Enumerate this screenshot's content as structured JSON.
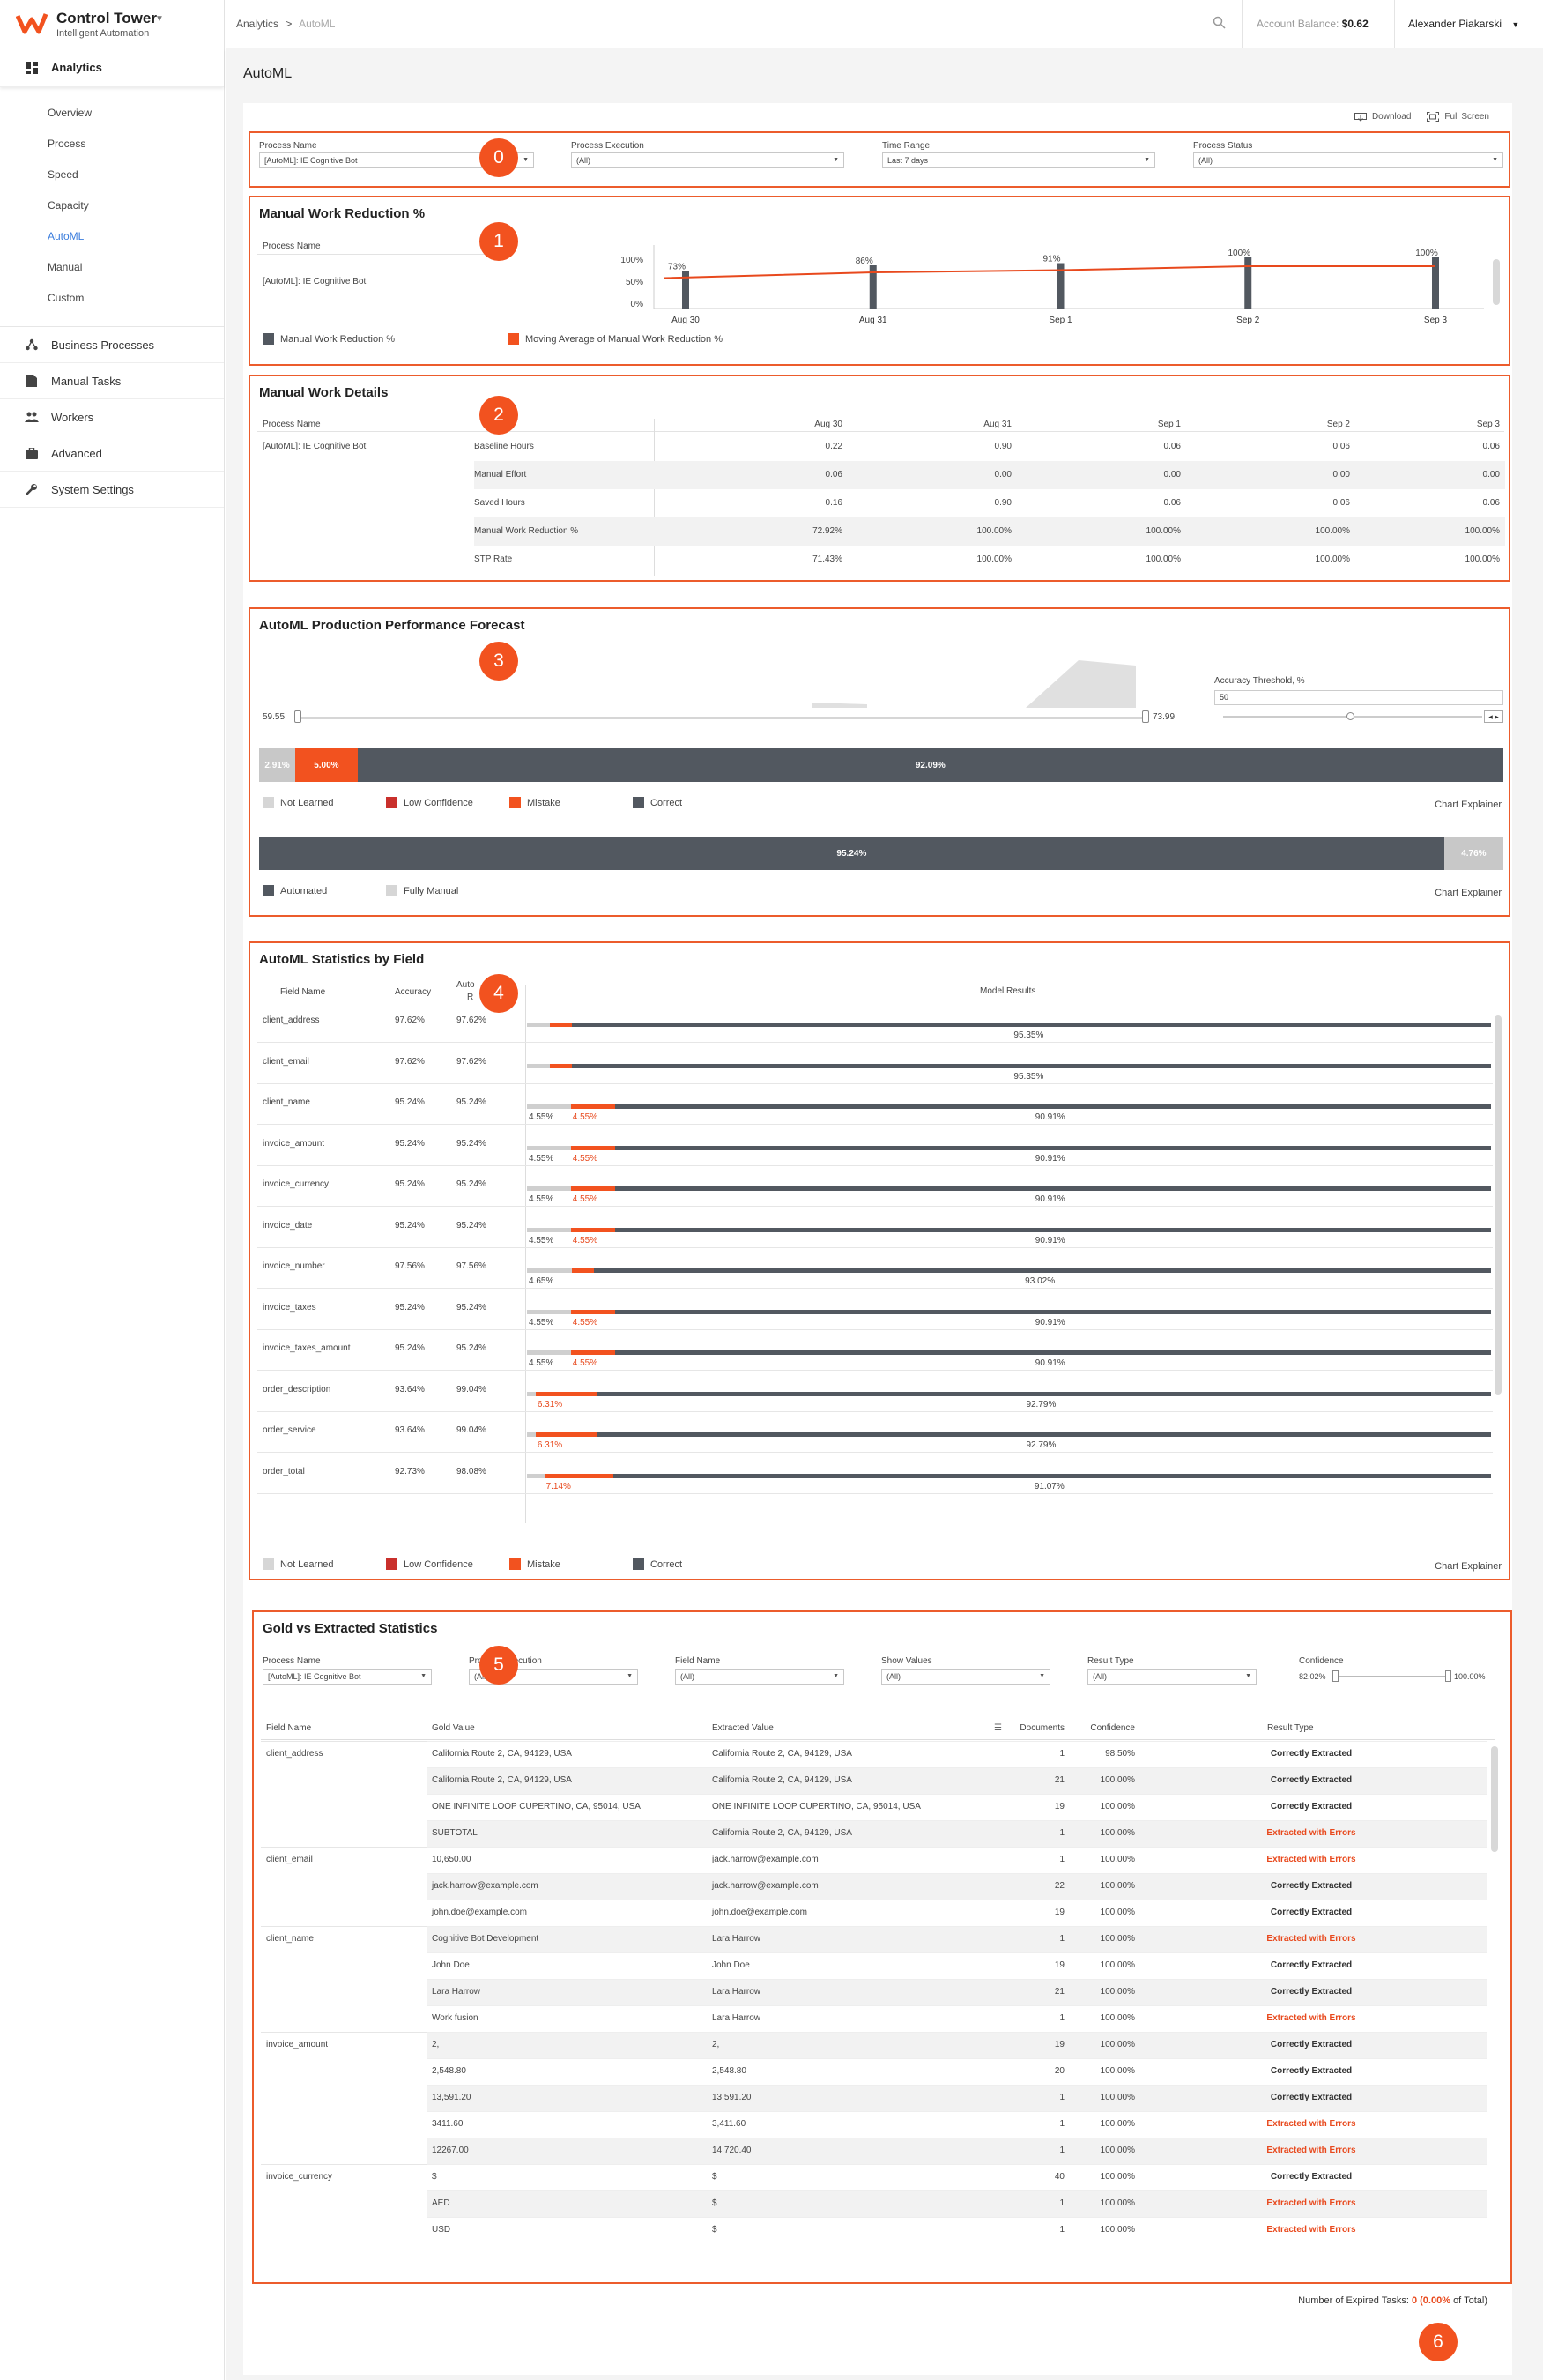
{
  "app": {
    "name": "Control Tower",
    "subtitle": "Intelligent Automation"
  },
  "sidebar": {
    "main": "Analytics",
    "sub": [
      "Overview",
      "Process",
      "Speed",
      "Capacity",
      "AutoML",
      "Manual",
      "Custom"
    ],
    "items": [
      "Business Processes",
      "Manual Tasks",
      "Workers",
      "Advanced",
      "System Settings"
    ]
  },
  "topbar": {
    "crumb1": "Analytics",
    "crumb_sep": ">",
    "crumb2": "AutoML",
    "balance_label": "Account Balance:",
    "balance_value": "$0.62",
    "user": "Alexander Piakarski"
  },
  "page": {
    "title": "AutoML",
    "download": "Download",
    "fullscreen": "Full Screen"
  },
  "badges": [
    "0",
    "1",
    "2",
    "3",
    "4",
    "5",
    "6"
  ],
  "filters": {
    "process_name_label": "Process Name",
    "process_name_value": "[AutoML]: IE Cognitive Bot",
    "process_exec_label": "Process Execution",
    "process_exec_value": "(All)",
    "time_range_label": "Time Range",
    "time_range_value": "Last 7 days",
    "process_status_label": "Process Status",
    "process_status_value": "(All)"
  },
  "mwr": {
    "title": "Manual Work Reduction %",
    "col": "Process Name",
    "process": "[AutoML]: IE Cognitive Bot",
    "legend1": "Manual Work Reduction %",
    "legend2": "Moving Average of Manual Work Reduction %"
  },
  "chart_data": {
    "type": "bar",
    "categories": [
      "Aug 30",
      "Aug 31",
      "Sep 1",
      "Sep 2",
      "Sep 3"
    ],
    "series": [
      {
        "name": "Manual Work Reduction %",
        "values": [
          73,
          86,
          91,
          100,
          100
        ]
      },
      {
        "name": "Moving Average of Manual Work Reduction %",
        "values": [
          73,
          86,
          91,
          100,
          100
        ]
      }
    ],
    "ylim": [
      0,
      100
    ],
    "yticks": [
      "100%",
      "50%",
      "0%"
    ],
    "labels": [
      "73%",
      "86%",
      "91%",
      "100%",
      "100%"
    ],
    "colors": {
      "bar": "#525860",
      "line": "#e8491d"
    }
  },
  "mwd": {
    "title": "Manual Work Details",
    "col": "Process Name",
    "process": "[AutoML]: IE Cognitive Bot",
    "dates": [
      "Aug 30",
      "Aug 31",
      "Sep 1",
      "Sep 2",
      "Sep 3"
    ],
    "rows": [
      {
        "metric": "Baseline Hours",
        "v": [
          "0.22",
          "0.90",
          "0.06",
          "0.06",
          "0.06"
        ]
      },
      {
        "metric": "Manual Effort",
        "v": [
          "0.06",
          "0.00",
          "0.00",
          "0.00",
          "0.00"
        ]
      },
      {
        "metric": "Saved Hours",
        "v": [
          "0.16",
          "0.90",
          "0.06",
          "0.06",
          "0.06"
        ]
      },
      {
        "metric": "Manual Work Reduction %",
        "v": [
          "72.92%",
          "100.00%",
          "100.00%",
          "100.00%",
          "100.00%"
        ]
      },
      {
        "metric": "STP Rate",
        "v": [
          "71.43%",
          "100.00%",
          "100.00%",
          "100.00%",
          "100.00%"
        ]
      }
    ]
  },
  "forecast": {
    "title": "AutoML Production Performance Forecast",
    "slider_min": "59.55",
    "slider_max": "73.99",
    "threshold_label": "Accuracy Threshold, %",
    "threshold_value": "50",
    "bar1": [
      {
        "label": "2.91%",
        "value": 2.91,
        "color": "#c8c8c8"
      },
      {
        "label": "5.00%",
        "value": 5.0,
        "color": "#f2521f"
      },
      {
        "label": "92.09%",
        "value": 92.09,
        "color": "#525860"
      }
    ],
    "legend1": [
      "Not Learned",
      "Low Confidence",
      "Mistake",
      "Correct"
    ],
    "bar2": [
      {
        "label": "95.24%",
        "value": 95.24,
        "color": "#525860"
      },
      {
        "label": "4.76%",
        "value": 4.76,
        "color": "#c8c8c8"
      }
    ],
    "legend2": [
      "Automated",
      "Fully Manual"
    ],
    "explainer": "Chart Explainer"
  },
  "stats": {
    "title": "AutoML Statistics by Field",
    "h_field": "Field Name",
    "h_acc": "Accuracy",
    "h_auto": "Auto",
    "h_auto2": "R",
    "h_model": "Model Results",
    "rows": [
      {
        "f": "client_address",
        "a": "97.62%",
        "r": "97.62%",
        "nl": 2.38,
        "lo": 0,
        "mi": 2.27,
        "nlL": "",
        "miL": "",
        "co": "95.35%"
      },
      {
        "f": "client_email",
        "a": "97.62%",
        "r": "97.62%",
        "nl": 2.38,
        "lo": 0,
        "mi": 2.27,
        "nlL": "",
        "miL": "",
        "co": "95.35%"
      },
      {
        "f": "client_name",
        "a": "95.24%",
        "r": "95.24%",
        "nl": 4.55,
        "lo": 0,
        "mi": 4.55,
        "nlL": "4.55%",
        "miL": "4.55%",
        "co": "90.91%"
      },
      {
        "f": "invoice_amount",
        "a": "95.24%",
        "r": "95.24%",
        "nl": 4.55,
        "lo": 0,
        "mi": 4.55,
        "nlL": "4.55%",
        "miL": "4.55%",
        "co": "90.91%"
      },
      {
        "f": "invoice_currency",
        "a": "95.24%",
        "r": "95.24%",
        "nl": 4.55,
        "lo": 0,
        "mi": 4.55,
        "nlL": "4.55%",
        "miL": "4.55%",
        "co": "90.91%"
      },
      {
        "f": "invoice_date",
        "a": "95.24%",
        "r": "95.24%",
        "nl": 4.55,
        "lo": 0,
        "mi": 4.55,
        "nlL": "4.55%",
        "miL": "4.55%",
        "co": "90.91%"
      },
      {
        "f": "invoice_number",
        "a": "97.56%",
        "r": "97.56%",
        "nl": 4.65,
        "lo": 0,
        "mi": 2.33,
        "nlL": "4.65%",
        "miL": "",
        "co": "93.02%"
      },
      {
        "f": "invoice_taxes",
        "a": "95.24%",
        "r": "95.24%",
        "nl": 4.55,
        "lo": 0,
        "mi": 4.55,
        "nlL": "4.55%",
        "miL": "4.55%",
        "co": "90.91%"
      },
      {
        "f": "invoice_taxes_amount",
        "a": "95.24%",
        "r": "95.24%",
        "nl": 4.55,
        "lo": 0,
        "mi": 4.55,
        "nlL": "4.55%",
        "miL": "4.55%",
        "co": "90.91%"
      },
      {
        "f": "order_description",
        "a": "93.64%",
        "r": "99.04%",
        "nl": 0.9,
        "lo": 0,
        "mi": 6.31,
        "nlL": "",
        "miL": "6.31%",
        "co": "92.79%"
      },
      {
        "f": "order_service",
        "a": "93.64%",
        "r": "99.04%",
        "nl": 0.9,
        "lo": 0,
        "mi": 6.31,
        "nlL": "",
        "miL": "6.31%",
        "co": "92.79%"
      },
      {
        "f": "order_total",
        "a": "92.73%",
        "r": "98.08%",
        "nl": 1.79,
        "lo": 0,
        "mi": 7.14,
        "nlL": "",
        "miL": "7.14%",
        "co": "91.07%"
      }
    ],
    "legend": [
      "Not Learned",
      "Low Confidence",
      "Mistake",
      "Correct"
    ],
    "explainer": "Chart Explainer"
  },
  "gold": {
    "title": "Gold vs Extracted Statistics",
    "filters": [
      {
        "label": "Process Name",
        "value": "[AutoML]: IE Cognitive Bot"
      },
      {
        "label": "Process Execution",
        "value": "(All)"
      },
      {
        "label": "Field Name",
        "value": "(All)"
      },
      {
        "label": "Show Values",
        "value": "(All)"
      },
      {
        "label": "Result Type",
        "value": "(All)"
      }
    ],
    "conf_label": "Confidence",
    "conf_min": "82.02%",
    "conf_max": "100.00%",
    "headers": [
      "Field Name",
      "Gold Value",
      "Extracted Value",
      "Documents",
      "Confidence",
      "Result Type"
    ],
    "rows": [
      {
        "f": "client_address",
        "g": "California Route 2, CA, 94129, USA",
        "e": "California Route 2, CA, 94129, USA",
        "d": "1",
        "c": "98.50%",
        "r": "Correctly Extracted",
        "err": false
      },
      {
        "f": "",
        "g": "California Route 2, CA, 94129, USA",
        "e": "California Route 2, CA, 94129, USA",
        "d": "21",
        "c": "100.00%",
        "r": "Correctly Extracted",
        "err": false
      },
      {
        "f": "",
        "g": "ONE INFINITE LOOP CUPERTINO, CA, 95014, USA",
        "e": "ONE INFINITE LOOP CUPERTINO, CA, 95014, USA",
        "d": "19",
        "c": "100.00%",
        "r": "Correctly Extracted",
        "err": false
      },
      {
        "f": "",
        "g": "SUBTOTAL",
        "e": "California Route 2, CA, 94129, USA",
        "d": "1",
        "c": "100.00%",
        "r": "Extracted with Errors",
        "err": true
      },
      {
        "f": "client_email",
        "g": "10,650.00",
        "e": "jack.harrow@example.com",
        "d": "1",
        "c": "100.00%",
        "r": "Extracted with Errors",
        "err": true
      },
      {
        "f": "",
        "g": "jack.harrow@example.com",
        "e": "jack.harrow@example.com",
        "d": "22",
        "c": "100.00%",
        "r": "Correctly Extracted",
        "err": false
      },
      {
        "f": "",
        "g": "john.doe@example.com",
        "e": "john.doe@example.com",
        "d": "19",
        "c": "100.00%",
        "r": "Correctly Extracted",
        "err": false
      },
      {
        "f": "client_name",
        "g": "Cognitive Bot Development",
        "e": "Lara Harrow",
        "d": "1",
        "c": "100.00%",
        "r": "Extracted with Errors",
        "err": true
      },
      {
        "f": "",
        "g": "John Doe",
        "e": "John Doe",
        "d": "19",
        "c": "100.00%",
        "r": "Correctly Extracted",
        "err": false
      },
      {
        "f": "",
        "g": "Lara Harrow",
        "e": "Lara Harrow",
        "d": "21",
        "c": "100.00%",
        "r": "Correctly Extracted",
        "err": false
      },
      {
        "f": "",
        "g": "Work fusion",
        "e": "Lara Harrow",
        "d": "1",
        "c": "100.00%",
        "r": "Extracted with Errors",
        "err": true
      },
      {
        "f": "invoice_amount",
        "g": "2,",
        "e": "2,",
        "d": "19",
        "c": "100.00%",
        "r": "Correctly Extracted",
        "err": false
      },
      {
        "f": "",
        "g": "2,548.80",
        "e": "2,548.80",
        "d": "20",
        "c": "100.00%",
        "r": "Correctly Extracted",
        "err": false
      },
      {
        "f": "",
        "g": "13,591.20",
        "e": "13,591.20",
        "d": "1",
        "c": "100.00%",
        "r": "Correctly Extracted",
        "err": false
      },
      {
        "f": "",
        "g": "3411.60",
        "e": "3,411.60",
        "d": "1",
        "c": "100.00%",
        "r": "Extracted with Errors",
        "err": true
      },
      {
        "f": "",
        "g": "12267.00",
        "e": "14,720.40",
        "d": "1",
        "c": "100.00%",
        "r": "Extracted with Errors",
        "err": true
      },
      {
        "f": "invoice_currency",
        "g": "$",
        "e": "$",
        "d": "40",
        "c": "100.00%",
        "r": "Correctly Extracted",
        "err": false
      },
      {
        "f": "",
        "g": "AED",
        "e": "$",
        "d": "1",
        "c": "100.00%",
        "r": "Extracted with Errors",
        "err": true
      },
      {
        "f": "",
        "g": "USD",
        "e": "$",
        "d": "1",
        "c": "100.00%",
        "r": "Extracted with Errors",
        "err": true
      }
    ]
  },
  "footer": {
    "label": "Number of Expired Tasks:",
    "count": "0",
    "pct": "(0.00%",
    "suffix": "of Total)"
  }
}
